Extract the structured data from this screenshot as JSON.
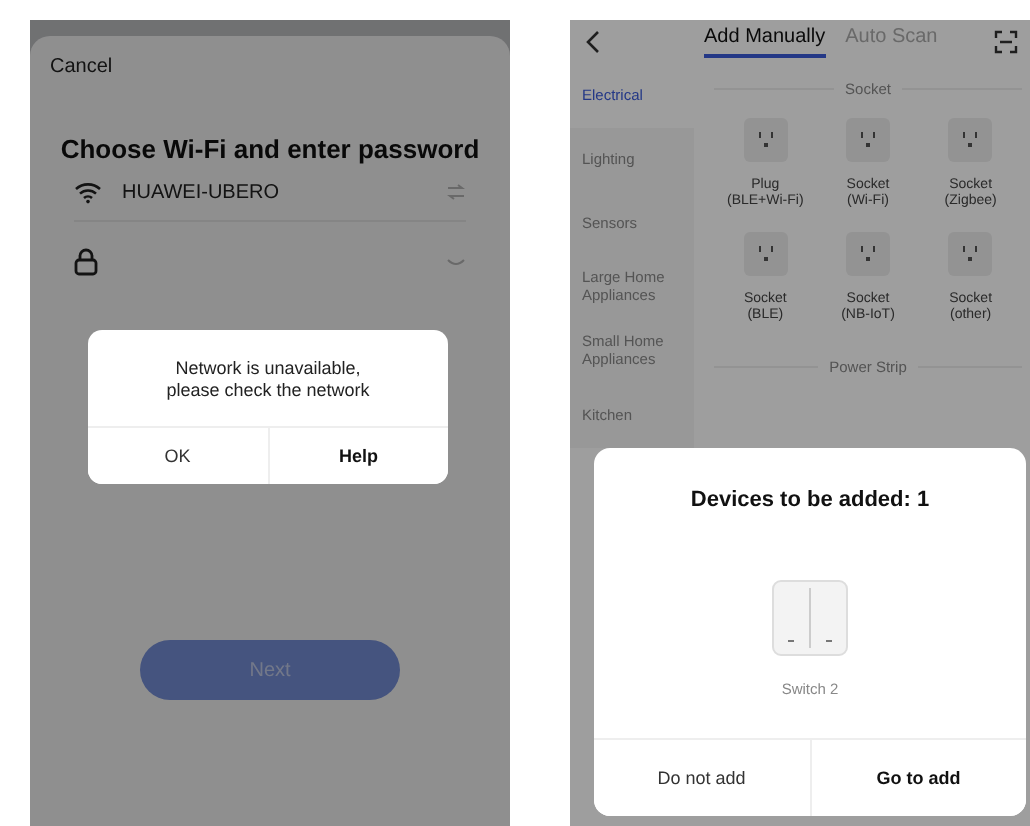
{
  "left_screen": {
    "cancel": "Cancel",
    "title": "Choose Wi-Fi and enter password",
    "wifi_name": "HUAWEI-UBERO",
    "next_button": "Next",
    "dialog": {
      "message": "Network is unavailable,\nplease check the network",
      "buttons": [
        {
          "label": "OK",
          "kind": "plain"
        },
        {
          "label": "Help",
          "kind": "bold"
        }
      ]
    }
  },
  "right_screen": {
    "tabs": [
      {
        "label": "Add Manually",
        "selected": true
      },
      {
        "label": "Auto Scan",
        "selected": false
      }
    ],
    "sidebar": {
      "items": [
        {
          "label": "Electrical",
          "selected": true
        },
        {
          "label": "Lighting",
          "selected": false
        },
        {
          "label": "Sensors",
          "selected": false
        },
        {
          "label": "Large Home Appliances",
          "selected": false
        },
        {
          "label": "Small Home Appliances",
          "selected": false
        },
        {
          "label": "Kitchen",
          "selected": false
        }
      ]
    },
    "sections": [
      {
        "title": "Socket",
        "devices": [
          {
            "name": "Plug\n(BLE+Wi-Fi)"
          },
          {
            "name": "Socket\n(Wi-Fi)"
          },
          {
            "name": "Socket\n(Zigbee)"
          },
          {
            "name": "Socket\n(BLE)"
          },
          {
            "name": "Socket\n(NB-IoT)"
          },
          {
            "name": "Socket\n(other)"
          }
        ]
      },
      {
        "title": "Power Strip"
      }
    ],
    "dialog": {
      "title": "Devices to be added: 1",
      "device": "Switch 2",
      "buttons": [
        {
          "label": "Do not add",
          "kind": "plain"
        },
        {
          "label": "Go to add",
          "kind": "bold"
        }
      ]
    }
  }
}
